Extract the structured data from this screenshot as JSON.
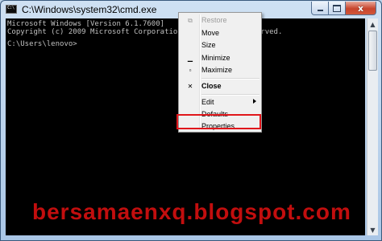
{
  "window": {
    "title": "C:\\Windows\\system32\\cmd.exe",
    "icon_text": "C:\\",
    "close_glyph": "x"
  },
  "console": {
    "lines": [
      "Microsoft Windows [Version 6.1.7600]",
      "Copyright (c) 2009 Microsoft Corporation.  All rights reserved."
    ],
    "prompt": "C:\\Users\\lenovo>"
  },
  "scrollbar": {
    "up_arrow": "▲",
    "down_arrow": "▼"
  },
  "menu": {
    "items": [
      {
        "label": "Restore",
        "icon": "restore-icon",
        "glyph": "⧉",
        "enabled": false
      },
      {
        "label": "Move",
        "enabled": true
      },
      {
        "label": "Size",
        "enabled": true
      },
      {
        "label": "Minimize",
        "icon": "minimize-icon",
        "glyph": "▁",
        "enabled": true
      },
      {
        "label": "Maximize",
        "icon": "maximize-icon",
        "glyph": "▫",
        "enabled": true
      },
      {
        "label": "Close",
        "icon": "close-icon",
        "glyph": "✕",
        "enabled": true,
        "bold": true
      },
      {
        "label": "Edit",
        "enabled": true,
        "submenu": true
      },
      {
        "label": "Defaults",
        "enabled": true
      },
      {
        "label": "Properties",
        "enabled": true,
        "highlighted": true
      }
    ]
  },
  "highlight_color": "#e0161b",
  "watermark": "bersamaenxq.blogspot.com"
}
